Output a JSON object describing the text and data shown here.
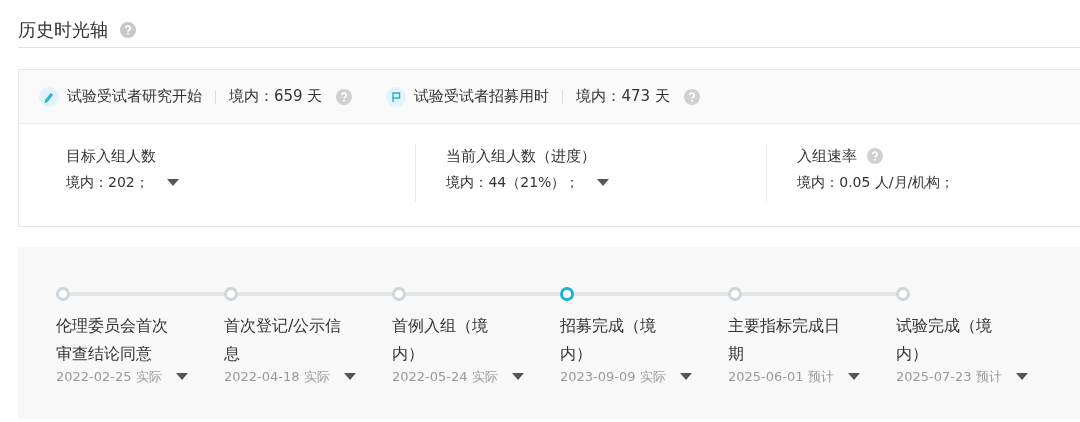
{
  "section": {
    "title": "历史时光轴"
  },
  "summary": [
    {
      "kind": "pen",
      "label": "试验受试者研究开始",
      "value": "境内：659 天"
    },
    {
      "kind": "flag",
      "label": "试验受试者招募用时",
      "value": "境内：473 天"
    }
  ],
  "stats": [
    {
      "label": "目标入组人数",
      "value": "境内：202；",
      "help": false,
      "dropdown": true
    },
    {
      "label": "当前入组人数（进度）",
      "value": "境内：44（21%）；",
      "help": false,
      "dropdown": true
    },
    {
      "label": "入组速率",
      "value": "境内：0.05 人/月/机构；",
      "help": true,
      "dropdown": false
    }
  ],
  "timeline": [
    {
      "title": "伦理委员会首次审查结论同意",
      "date": "2022-02-25 实际",
      "selected": false
    },
    {
      "title": "首次登记/公示信息",
      "date": "2022-04-18 实际",
      "selected": false
    },
    {
      "title": "首例入组（境内）",
      "date": "2022-05-24 实际",
      "selected": false
    },
    {
      "title": "招募完成（境内）",
      "date": "2023-09-09 实际",
      "selected": true
    },
    {
      "title": "主要指标完成日期",
      "date": "2025-06-01 预计",
      "selected": false
    },
    {
      "title": "试验完成（境内）",
      "date": "2025-07-23 预计",
      "selected": false
    }
  ]
}
